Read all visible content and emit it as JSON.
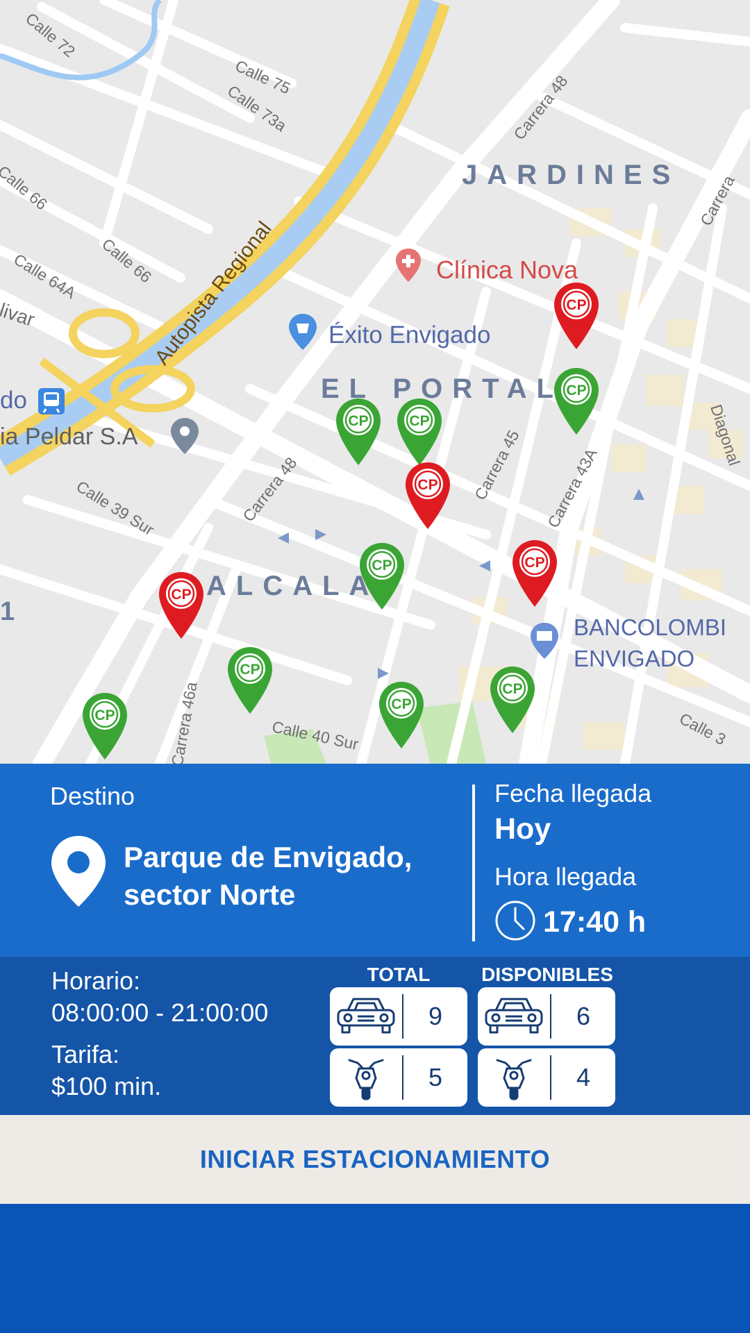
{
  "map": {
    "neighborhoods": [
      "JARDINES",
      "EL PORTAL",
      "ALCALA"
    ],
    "highway": "Autopista Regional",
    "streets": [
      "Calle 75",
      "Calle 73a",
      "Carrera 48",
      "Carrera 48",
      "Calle 64A",
      "Calle 66",
      "Calle 66",
      "Calle 39 Sur",
      "Carrera 45",
      "Carrera 43A",
      "Diagonal",
      "Calle 40 Sur",
      "Carrera 46a",
      "Calle 72",
      "Calle 3",
      "Carrera",
      "livar"
    ],
    "pois": {
      "clinica": "Clínica Nova",
      "exito": "Éxito Envigado",
      "peldar": "ia Peldar S.A",
      "metro": "do",
      "bank_line1": "BANCOLOMBI",
      "bank_line2": "ENVIGADO"
    },
    "edge_label": "1",
    "pin_label": "CP",
    "pin_colors": {
      "available": "#3aa535",
      "occupied": "#df1b22"
    }
  },
  "destination": {
    "label": "Destino",
    "name": "Parque de Envigado, sector Norte"
  },
  "arrival": {
    "date_label": "Fecha llegada",
    "date_value": "Hoy",
    "time_label": "Hora llegada",
    "time_value": "17:40 h"
  },
  "info": {
    "schedule_label": "Horario:",
    "schedule_value": "08:00:00 - 21:00:00",
    "rate_label": "Tarifa:",
    "rate_value": "$100 min."
  },
  "capacity": {
    "total_label": "TOTAL",
    "available_label": "DISPONIBLES",
    "total_cars": "9",
    "total_motos": "5",
    "available_cars": "6",
    "available_motos": "4"
  },
  "cta_label": "INICIAR ESTACIONAMIENTO",
  "colors": {
    "primary": "#1a6ccb",
    "secondary": "#1555a8",
    "cta_text": "#1a64c2",
    "bottom": "#0a54b8"
  }
}
